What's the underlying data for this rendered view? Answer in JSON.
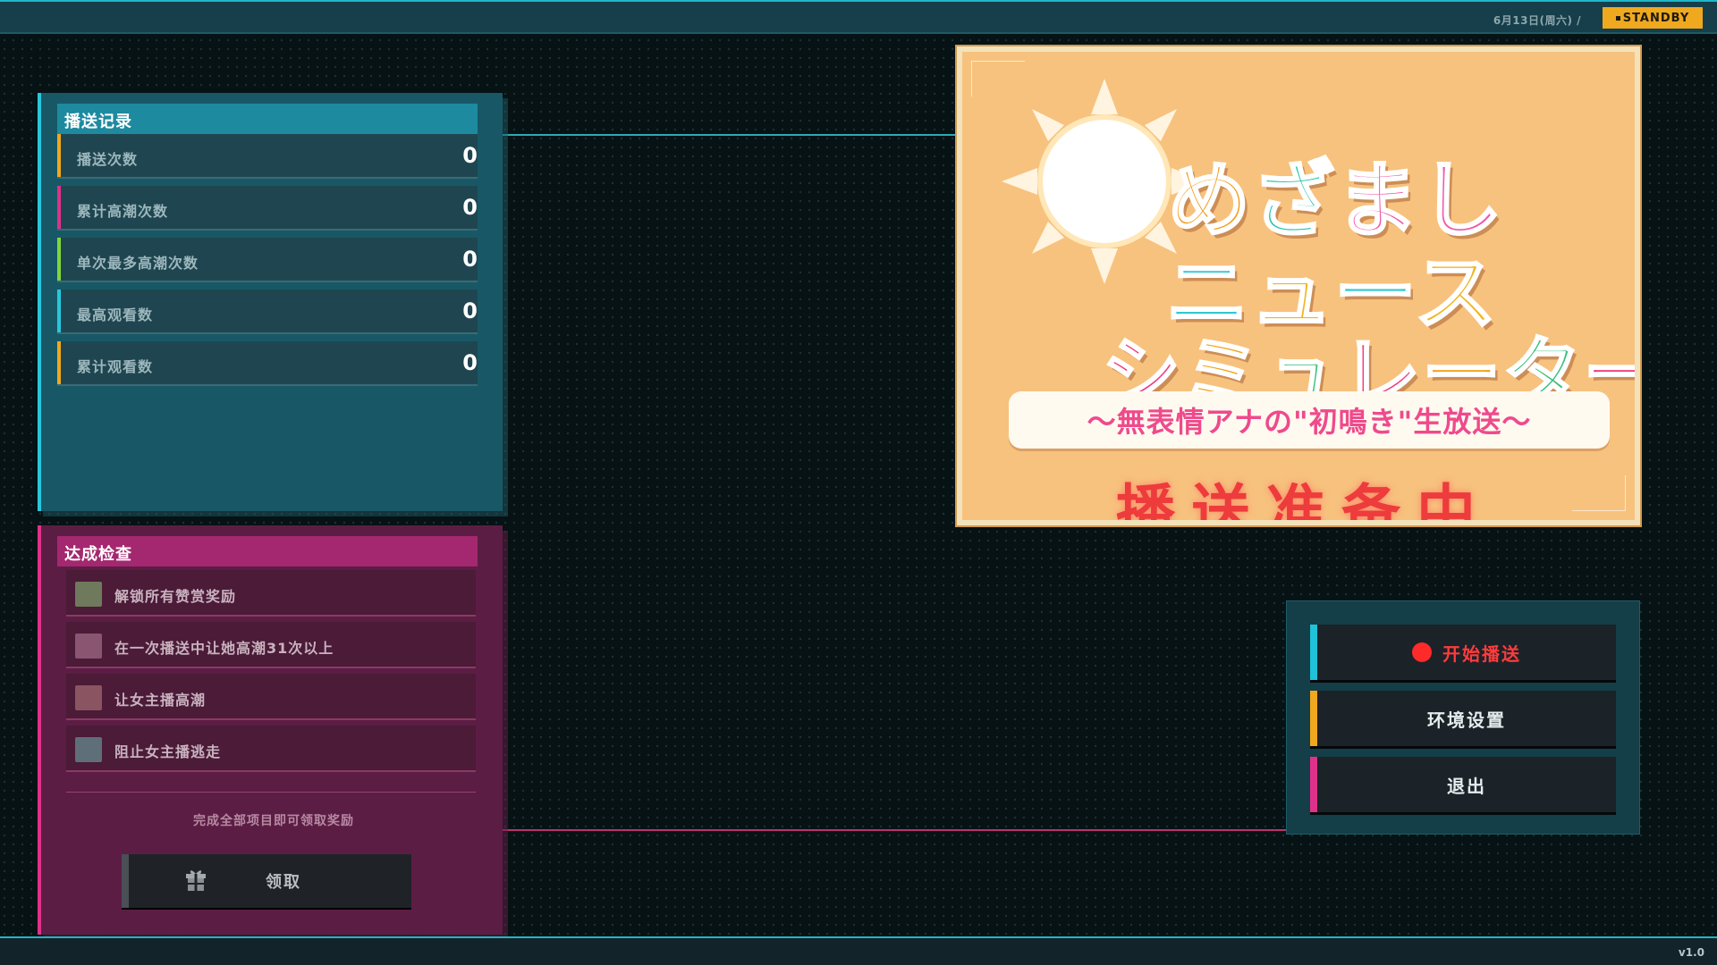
{
  "topbar": {
    "date": "6月13日(周六) /",
    "status": "STANDBY"
  },
  "footer": {
    "version": "v1.0"
  },
  "stats": {
    "title": "播送记录",
    "rows": [
      {
        "label": "播送次数",
        "value": "0",
        "accent": "#f0a81e"
      },
      {
        "label": "累计高潮次数",
        "value": "0",
        "accent": "#e0318a"
      },
      {
        "label": "单次最多高潮次数",
        "value": "0",
        "accent": "#7fd83a"
      },
      {
        "label": "最高观看数",
        "value": "0",
        "accent": "#28c7dc"
      },
      {
        "label": "累计观看数",
        "value": "0",
        "accent": "#f0a81e"
      }
    ]
  },
  "achievements": {
    "title": "达成检查",
    "items": [
      {
        "label": "解锁所有赞赏奖励",
        "box_color": "#6f7a5c"
      },
      {
        "label": "在一次播送中让她高潮31次以上",
        "box_color": "#8a5570"
      },
      {
        "label": "让女主播高潮",
        "box_color": "#8a5560"
      },
      {
        "label": "阻止女主播逃走",
        "box_color": "#5f6f7a"
      }
    ],
    "hint": "完成全部项目即可领取奖励",
    "claim_label": "领取"
  },
  "title_card": {
    "logo_line1": [
      "め",
      "ざ",
      "ま",
      "し"
    ],
    "logo_line2": [
      "ニ",
      "ュ",
      "ー",
      "ス"
    ],
    "logo_line3": [
      "シ",
      "ミ",
      "ュ",
      "レ",
      "ー",
      "タ",
      "ー"
    ],
    "subtitle": "～無表情アナの\"初鳴き\"生放送～",
    "status_text": "播送准备中"
  },
  "menu": {
    "start_label": "开始播送",
    "settings_label": "环境设置",
    "exit_label": "退出",
    "start_color": "#1fc2d8",
    "settings_color": "#f0a81e",
    "exit_color": "#e0318a"
  }
}
